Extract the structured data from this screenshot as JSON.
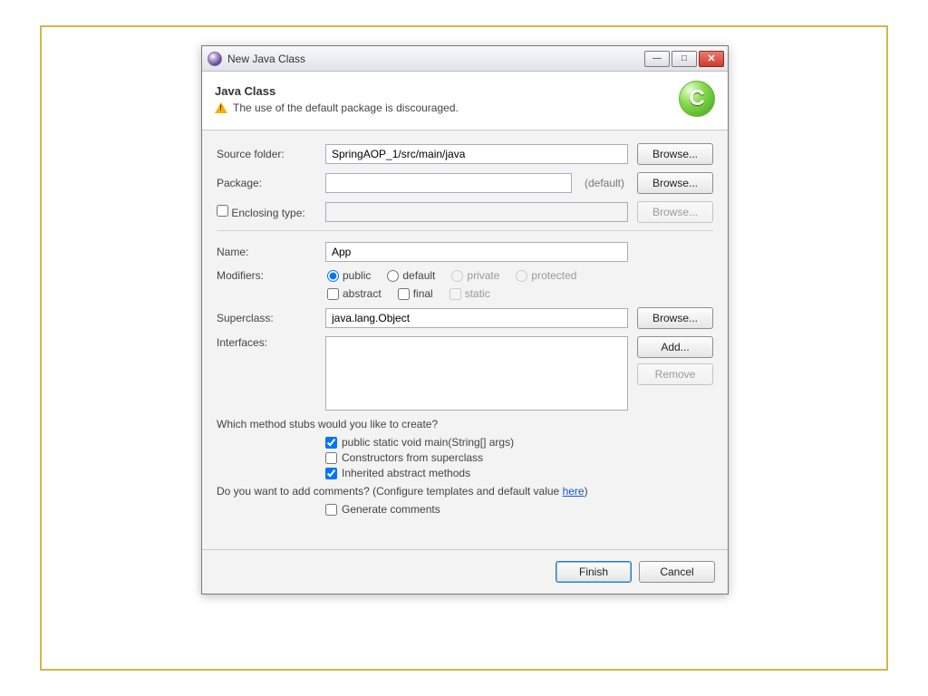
{
  "titlebar": {
    "title": "New Java Class"
  },
  "banner": {
    "title": "Java Class",
    "message": "The use of the default package is discouraged."
  },
  "labels": {
    "source_folder": "Source folder:",
    "package": "Package:",
    "enclosing_type": "Enclosing type:",
    "name": "Name:",
    "modifiers": "Modifiers:",
    "superclass": "Superclass:",
    "interfaces": "Interfaces:",
    "default_tag": "(default)"
  },
  "values": {
    "source_folder": "SpringAOP_1/src/main/java",
    "package": "",
    "enclosing_type": "",
    "name": "App",
    "superclass": "java.lang.Object"
  },
  "modifiers": {
    "public": "public",
    "default": "default",
    "private": "private",
    "protected": "protected",
    "abstract": "abstract",
    "final": "final",
    "static": "static"
  },
  "buttons": {
    "browse": "Browse...",
    "add": "Add...",
    "remove": "Remove",
    "finish": "Finish",
    "cancel": "Cancel"
  },
  "stubs": {
    "question": "Which method stubs would you like to create?",
    "main": "public static void main(String[] args)",
    "constructors": "Constructors from superclass",
    "inherited": "Inherited abstract methods"
  },
  "comments": {
    "question_pre": "Do you want to add comments? (Configure templates and default value ",
    "link": "here",
    "question_post": ")",
    "generate": "Generate comments"
  }
}
